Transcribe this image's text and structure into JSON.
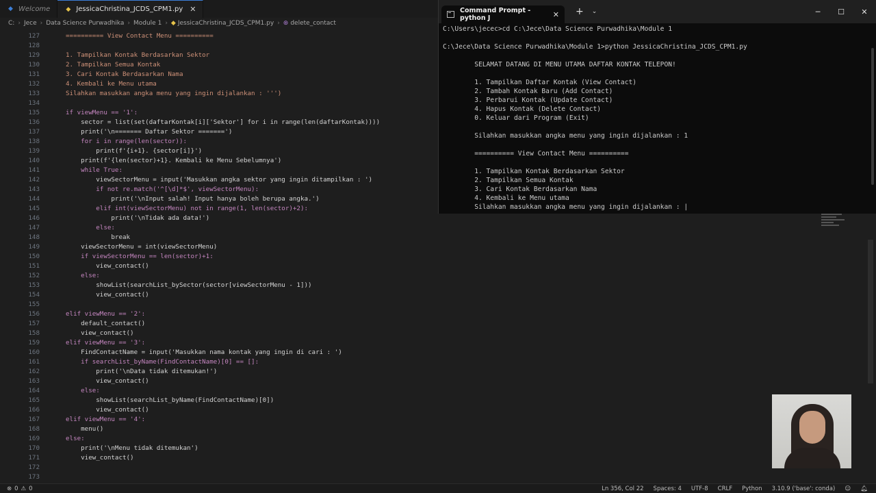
{
  "tabs": [
    {
      "label": "Welcome",
      "active": false
    },
    {
      "label": "JessicaChristina_JCDS_CPM1.py",
      "active": true
    }
  ],
  "breadcrumb": [
    "C:",
    "Jece",
    "Data Science Purwadhika",
    "Module 1",
    "JessicaChristina_JCDS_CPM1.py",
    "delete_contact"
  ],
  "editor": {
    "lines": [
      {
        "n": "127",
        "t": "========== View Contact Menu =========="
      },
      {
        "n": "128",
        "t": ""
      },
      {
        "n": "129",
        "t": "1. Tampilkan Kontak Berdasarkan Sektor"
      },
      {
        "n": "130",
        "t": "2. Tampilkan Semua Kontak"
      },
      {
        "n": "131",
        "t": "3. Cari Kontak Berdasarkan Nama"
      },
      {
        "n": "132",
        "t": "4. Kembali ke Menu utama"
      },
      {
        "n": "133",
        "t": "Silahkan masukkan angka menu yang ingin dijalankan : ''')"
      },
      {
        "n": "134",
        "t": ""
      },
      {
        "n": "135",
        "t": "if viewMenu == '1':"
      },
      {
        "n": "136",
        "t": "    sector = list(set(daftarKontak[i]['Sektor'] for i in range(len(daftarKontak))))"
      },
      {
        "n": "137",
        "t": "    print('\\n======= Daftar Sektor =======')"
      },
      {
        "n": "138",
        "t": "    for i in range(len(sector)):"
      },
      {
        "n": "139",
        "t": "        print(f'{i+1}. {sector[i]}')"
      },
      {
        "n": "140",
        "t": "    print(f'{len(sector)+1}. Kembali ke Menu Sebelumnya')"
      },
      {
        "n": "141",
        "t": "    while True:"
      },
      {
        "n": "142",
        "t": "        viewSectorMenu = input('Masukkan angka sektor yang ingin ditampilkan : ')"
      },
      {
        "n": "143",
        "t": "        if not re.match('^[\\d]*$', viewSectorMenu):"
      },
      {
        "n": "144",
        "t": "            print('\\nInput salah! Input hanya boleh berupa angka.')"
      },
      {
        "n": "145",
        "t": "        elif int(viewSectorMenu) not in range(1, len(sector)+2):"
      },
      {
        "n": "146",
        "t": "            print('\\nTidak ada data!')"
      },
      {
        "n": "147",
        "t": "        else:"
      },
      {
        "n": "148",
        "t": "            break"
      },
      {
        "n": "149",
        "t": "    viewSectorMenu = int(viewSectorMenu)"
      },
      {
        "n": "150",
        "t": "    if viewSectorMenu == len(sector)+1:"
      },
      {
        "n": "151",
        "t": "        view_contact()"
      },
      {
        "n": "152",
        "t": "    else:"
      },
      {
        "n": "153",
        "t": "        showList(searchList_bySector(sector[viewSectorMenu - 1]))"
      },
      {
        "n": "154",
        "t": "        view_contact()"
      },
      {
        "n": "155",
        "t": ""
      },
      {
        "n": "156",
        "t": "elif viewMenu == '2':"
      },
      {
        "n": "157",
        "t": "    default_contact()"
      },
      {
        "n": "158",
        "t": "    view_contact()"
      },
      {
        "n": "159",
        "t": "elif viewMenu == '3':"
      },
      {
        "n": "160",
        "t": "    FindContactName = input('Masukkan nama kontak yang ingin di cari : ')"
      },
      {
        "n": "161",
        "t": "    if searchList_byName(FindContactName)[0] == []:"
      },
      {
        "n": "162",
        "t": "        print('\\nData tidak ditemukan!')"
      },
      {
        "n": "163",
        "t": "        view_contact()"
      },
      {
        "n": "164",
        "t": "    else:"
      },
      {
        "n": "165",
        "t": "        showList(searchList_byName(FindContactName)[0])"
      },
      {
        "n": "166",
        "t": "        view_contact()"
      },
      {
        "n": "167",
        "t": "elif viewMenu == '4':"
      },
      {
        "n": "168",
        "t": "    menu()"
      },
      {
        "n": "169",
        "t": "else:"
      },
      {
        "n": "170",
        "t": "    print('\\nMenu tidak ditemukan')"
      },
      {
        "n": "171",
        "t": "    view_contact()"
      },
      {
        "n": "172",
        "t": ""
      },
      {
        "n": "173",
        "t": ""
      }
    ]
  },
  "statusbar": {
    "errors": "0",
    "warnings": "0",
    "position": "Ln 356, Col 22",
    "spaces": "Spaces: 4",
    "encoding": "UTF-8",
    "eol": "CRLF",
    "language": "Python",
    "interpreter": "3.10.9 ('base': conda)"
  },
  "cmd": {
    "tab_title": "Command Prompt - python  J",
    "lines": [
      "C:\\Users\\jecec>cd C:\\Jece\\Data Science Purwadhika\\Module 1",
      "",
      "C:\\Jece\\Data Science Purwadhika\\Module 1>python JessicaChristina_JCDS_CPM1.py",
      "",
      "        SELAMAT DATANG DI MENU UTAMA DAFTAR KONTAK TELEPON!",
      "",
      "        1. Tampilkan Daftar Kontak (View Contact)",
      "        2. Tambah Kontak Baru (Add Contact)",
      "        3. Perbarui Kontak (Update Contact)",
      "        4. Hapus Kontak (Delete Contact)",
      "        0. Keluar dari Program (Exit)",
      "",
      "        Silahkan masukkan angka menu yang ingin dijalankan : 1",
      "",
      "        ========== View Contact Menu ==========",
      "",
      "        1. Tampilkan Kontak Berdasarkan Sektor",
      "        2. Tampilkan Semua Kontak",
      "        3. Cari Kontak Berdasarkan Nama",
      "        4. Kembali ke Menu utama",
      "        Silahkan masukkan angka menu yang ingin dijalankan : |"
    ]
  }
}
